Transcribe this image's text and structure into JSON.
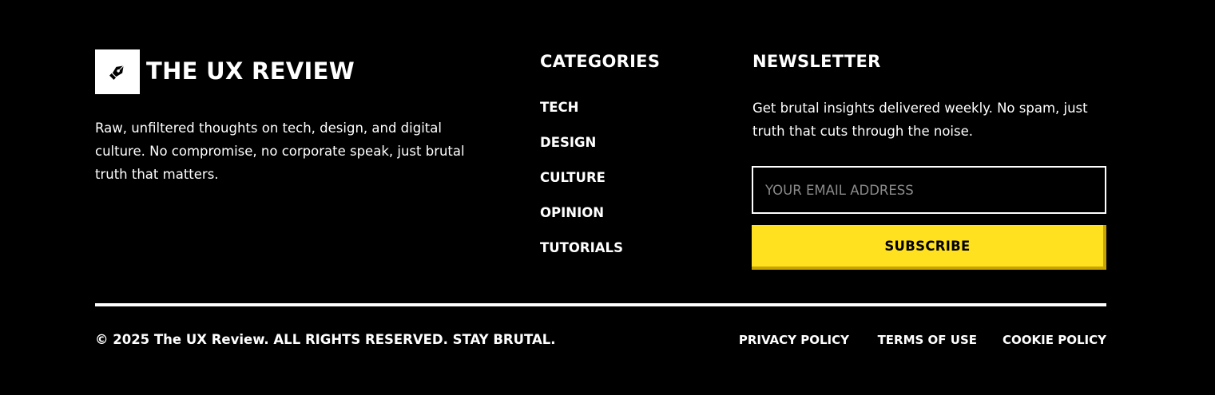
{
  "brand": {
    "name": "THE UX REVIEW",
    "logo_icon": "pen-nib-icon",
    "description": "Raw, unfiltered thoughts on tech, design, and digital culture. No compromise, no corporate speak, just brutal truth that matters."
  },
  "categories": {
    "title": "CATEGORIES",
    "items": [
      {
        "label": "TECH"
      },
      {
        "label": "DESIGN"
      },
      {
        "label": "CULTURE"
      },
      {
        "label": "OPINION"
      },
      {
        "label": "TUTORIALS"
      }
    ]
  },
  "newsletter": {
    "title": "NEWSLETTER",
    "description": "Get brutal insights delivered weekly. No spam, just truth that cuts through the noise.",
    "email_placeholder": "YOUR EMAIL ADDRESS",
    "email_value": "",
    "subscribe_label": "SUBSCRIBE"
  },
  "bottom": {
    "copyright": "© 2025 The UX Review. ALL RIGHTS RESERVED. STAY BRUTAL.",
    "links": [
      {
        "label": "PRIVACY POLICY"
      },
      {
        "label": "TERMS OF USE"
      },
      {
        "label": "COOKIE POLICY"
      }
    ]
  },
  "colors": {
    "background": "#000000",
    "text": "#ffffff",
    "accent": "#ffe11f",
    "accent_shadow": "#c8a400",
    "placeholder": "#8a8a8a"
  }
}
